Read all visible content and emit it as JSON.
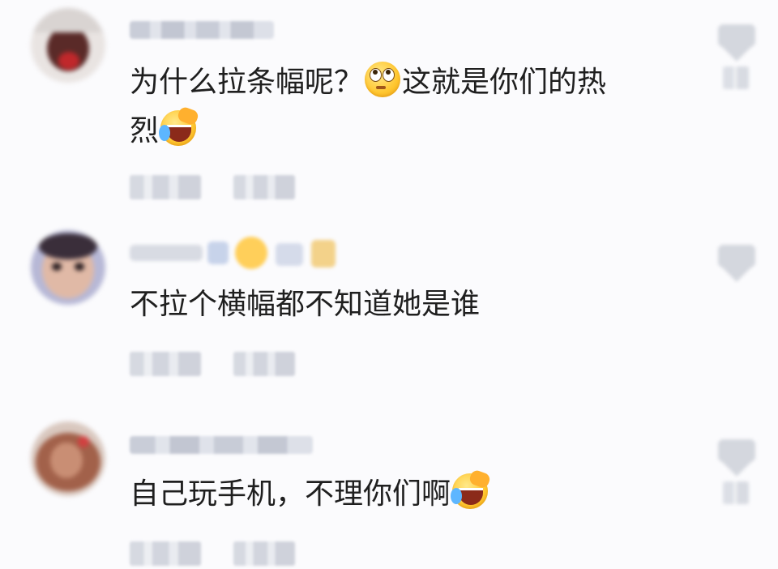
{
  "comments": [
    {
      "text_parts": [
        "为什么拉条幅呢？",
        "这就是你们的热",
        "烈"
      ],
      "emojis": [
        "thinking-eyes-emoji-icon",
        "laughing-tears-emoji-icon"
      ]
    },
    {
      "text": "不拉个横幅都不知道她是谁"
    },
    {
      "text_parts": [
        "自己玩手机，不理你们啊"
      ],
      "emojis": [
        "laughing-tears-emoji-icon"
      ]
    }
  ],
  "icons": {
    "like": "heart-icon",
    "avatar": "avatar"
  },
  "colors": {
    "background": "#fbfbfd",
    "text": "#1f1f1f",
    "blurred_meta": "#d6d9e1"
  }
}
